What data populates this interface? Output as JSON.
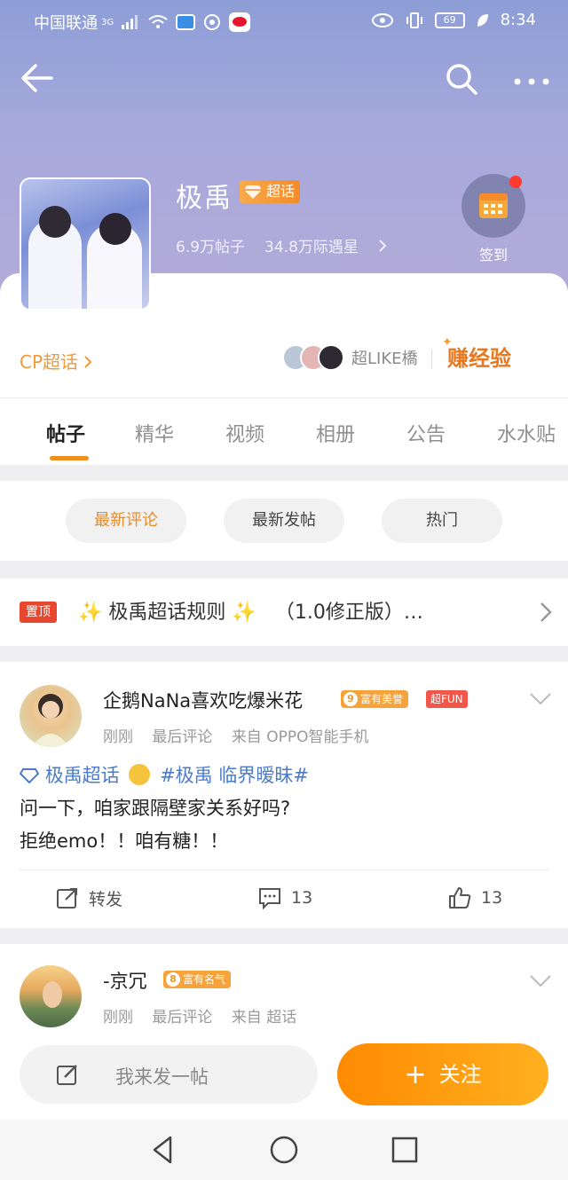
{
  "status_bar": {
    "carrier": "中国联通",
    "network": "3G",
    "battery": "69",
    "time": "8:34"
  },
  "header": {
    "topic_name": "极禹",
    "topic_type_badge": "超话",
    "posts_count": "6.9万帖子",
    "members": "34.8万际遇星",
    "checkin_label": "签到"
  },
  "sub_info": {
    "cp_link": "CP超话",
    "fans_label": "超LIKE橋",
    "earn_label": "赚经验"
  },
  "tabs": [
    {
      "label": "帖子"
    },
    {
      "label": "精华"
    },
    {
      "label": "视频"
    },
    {
      "label": "相册"
    },
    {
      "label": "公告"
    },
    {
      "label": "水水贴"
    }
  ],
  "sort_buttons": [
    {
      "label": "最新评论"
    },
    {
      "label": "最新发帖"
    },
    {
      "label": "热门"
    }
  ],
  "pinned": {
    "tag": "置顶",
    "spark_left": "✨",
    "title": "极禹超话规则",
    "spark_right": "✨",
    "subtitle": "（1.0修正版）…"
  },
  "posts": [
    {
      "username": "企鹅NaNa喜欢吃爆米花",
      "level": "9",
      "badge": "富有美誉",
      "fun_badge": "超FUN",
      "time": "刚刚",
      "activity": "最后评论",
      "source": "来自 OPPO智能手机",
      "topic_link": "极禹超话",
      "hashtag": "#极禹 临界暧昧#",
      "line2": "问一下，咱家跟隔壁家关系好吗?",
      "line3": "拒绝emo！！咱有糖！！",
      "repost_label": "转发",
      "comments": "13",
      "likes": "13"
    },
    {
      "username": "-京冗",
      "level": "8",
      "badge": "富有名气",
      "time": "刚刚",
      "activity": "最后评论",
      "source": "来自 超话"
    }
  ],
  "bottom": {
    "compose_placeholder": "我来发一帖",
    "follow_label": "关注"
  },
  "colors": {
    "accent": "#f18f1c",
    "link": "#4b7bc7",
    "pin_tag": "#e8472f"
  }
}
